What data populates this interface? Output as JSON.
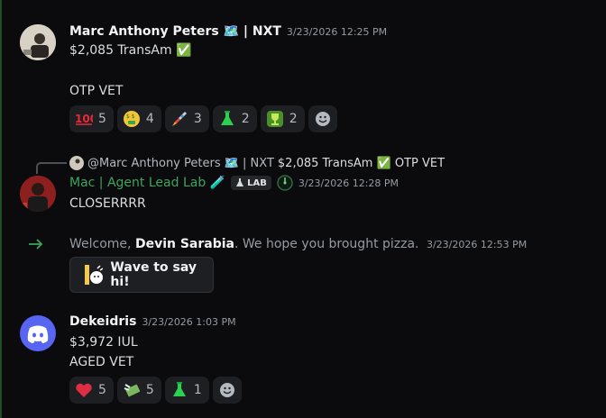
{
  "messages": [
    {
      "author": "Marc Anthony Peters 🗺️ | NXT",
      "timestamp": "3/23/2026 12:25 PM",
      "lines": [
        "$2,085 TransAm ✅",
        "OTP VET"
      ],
      "reactions": [
        {
          "emoji": "hundred-points",
          "glyph": "💯",
          "count": "5"
        },
        {
          "emoji": "money-mouth-face",
          "glyph": "🤑",
          "count": "4"
        },
        {
          "emoji": "rocket",
          "glyph": "🚀",
          "count": "3"
        },
        {
          "emoji": "test-flask",
          "glyph": "⚗",
          "count": "2"
        },
        {
          "emoji": "trophy",
          "glyph": "🏆",
          "count": "2"
        }
      ]
    },
    {
      "reply_preview": {
        "author": "@Marc Anthony Peters 🗺️ | NXT",
        "text": "$2,085 TransAm ✅ OTP VET"
      },
      "author": "Mac | Agent Lead Lab 🧪",
      "author_color": "#3ba55d",
      "badge": "LAB",
      "timestamp": "3/23/2026 12:28 PM",
      "lines": [
        "CLOSERRRR"
      ]
    },
    {
      "system": true,
      "prefix": "Welcome, ",
      "name": "Devin Sarabia",
      "suffix": ". We hope you brought pizza.",
      "timestamp": "3/23/2026 12:53 PM",
      "wave_label": "Wave to say hi!"
    },
    {
      "author": "Dekeidris",
      "timestamp": "3/23/2026 1:03 PM",
      "lines": [
        "$3,972 IUL",
        "AGED VET"
      ],
      "reactions": [
        {
          "emoji": "red-heart",
          "glyph": "❤️",
          "count": "5"
        },
        {
          "emoji": "money-with-wings",
          "glyph": "💸",
          "count": "5"
        },
        {
          "emoji": "test-flask",
          "glyph": "⚗",
          "count": "1"
        }
      ]
    }
  ],
  "colors": {
    "background": "#0b0b0d",
    "system_arrow": "#3ba55d",
    "discord_blurple": "#5865f2"
  }
}
